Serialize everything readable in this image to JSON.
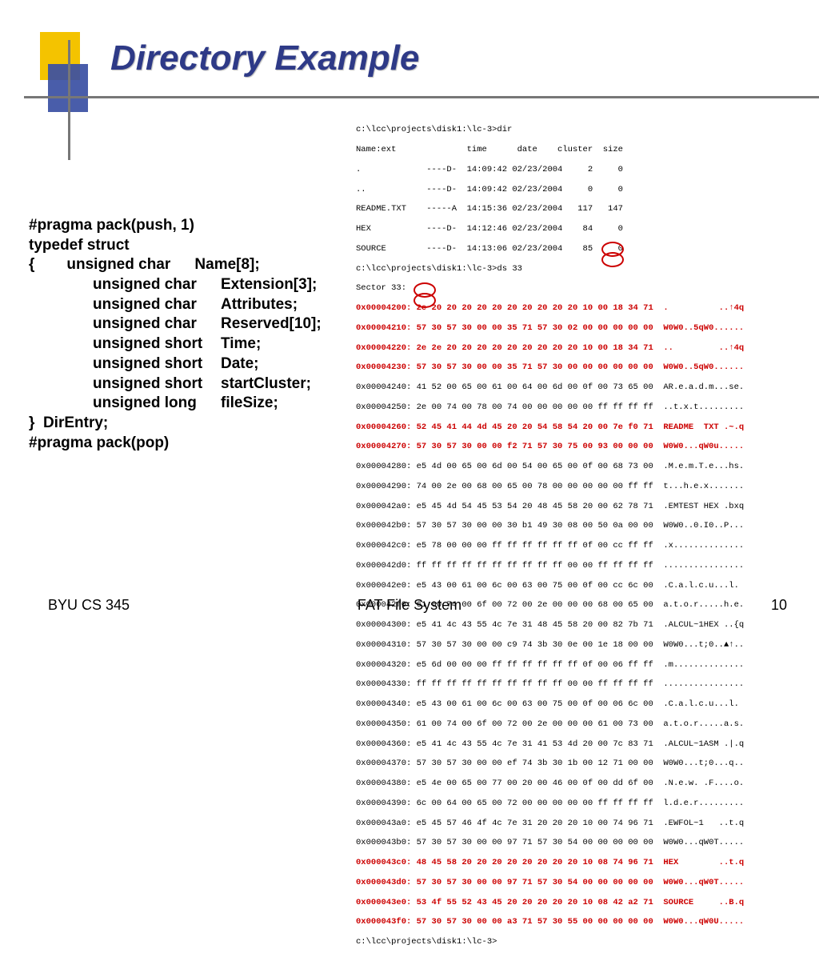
{
  "title": "Directory Example",
  "struct": {
    "l0": "#pragma pack(push, 1)",
    "l1": "typedef struct",
    "l2": "{",
    "f0t": "unsigned char",
    "f0n": "Name[8];",
    "f1t": "unsigned char",
    "f1n": "Extension[3];",
    "f2t": "unsigned char",
    "f2n": "Attributes;",
    "f3t": "unsigned char",
    "f3n": "Reserved[10];",
    "f4t": "unsigned short",
    "f4n": "Time;",
    "f5t": "unsigned short",
    "f5n": "Date;",
    "f6t": "unsigned short",
    "f6n": "startCluster;",
    "f7t": "unsigned long",
    "f7n": "fileSize;",
    "l3": "}  DirEntry;",
    "l4": "#pragma pack(pop)"
  },
  "hex": {
    "h00": "c:\\lcc\\projects\\disk1:\\lc-3>dir",
    "h01": "Name:ext              time      date    cluster  size",
    "h02": ".             ----D-  14:09:42 02/23/2004     2     0",
    "h03": "..            ----D-  14:09:42 02/23/2004     0     0",
    "h04": "README.TXT    -----A  14:15:36 02/23/2004   117   147",
    "h05": "HEX           ----D-  14:12:46 02/23/2004    84     0",
    "h06": "SOURCE        ----D-  14:13:06 02/23/2004    85     0",
    "h07": "c:\\lcc\\projects\\disk1:\\lc-3>ds 33",
    "h08": "Sector 33:",
    "r00": "0x00004200: 2e 20 20 20 20 20 20 20 20 20 20 10 00 18 34 71  .          ..↑4q",
    "r01": "0x00004210: 57 30 57 30 00 00 35 71 57 30 02 00 00 00 00 00  W0W0..5qW0......",
    "r02": "0x00004220: 2e 2e 20 20 20 20 20 20 20 20 20 10 00 18 34 71  ..         ..↑4q",
    "r03": "0x00004230: 57 30 57 30 00 00 35 71 57 30 00 00 00 00 00 00  W0W0..5qW0......",
    "b04": "0x00004240: 41 52 00 65 00 61 00 64 00 6d 00 0f 00 73 65 00  AR.e.a.d.m...se.",
    "b05": "0x00004250: 2e 00 74 00 78 00 74 00 00 00 00 00 ff ff ff ff  ..t.x.t.........",
    "r06": "0x00004260: 52 45 41 44 4d 45 20 20 54 58 54 20 00 7e f0 71  README  TXT .~.q",
    "r07": "0x00004270: 57 30 57 30 00 00 f2 71 57 30 75 00 93 00 00 00  W0W0...qW0u.....",
    "b08": "0x00004280: e5 4d 00 65 00 6d 00 54 00 65 00 0f 00 68 73 00  .M.e.m.T.e...hs.",
    "b09": "0x00004290: 74 00 2e 00 68 00 65 00 78 00 00 00 00 00 ff ff  t...h.e.x.......",
    "b10": "0x000042a0: e5 45 4d 54 45 53 54 20 48 45 58 20 00 62 78 71  .EMTEST HEX .bxq",
    "b11": "0x000042b0: 57 30 57 30 00 00 30 b1 49 30 08 00 50 0a 00 00  W0W0..0.I0..P...",
    "b12": "0x000042c0: e5 78 00 00 00 ff ff ff ff ff ff 0f 00 cc ff ff  .x..............",
    "b13": "0x000042d0: ff ff ff ff ff ff ff ff ff ff 00 00 ff ff ff ff  ................",
    "b14": "0x000042e0: e5 43 00 61 00 6c 00 63 00 75 00 0f 00 cc 6c 00  .C.a.l.c.u...l.",
    "b15": "0x000042f0: 61 00 74 00 6f 00 72 00 2e 00 00 00 68 00 65 00  a.t.o.r.....h.e.",
    "b16": "0x00004300: e5 41 4c 43 55 4c 7e 31 48 45 58 20 00 82 7b 71  .ALCUL~1HEX ..{q",
    "b17": "0x00004310: 57 30 57 30 00 00 c9 74 3b 30 0e 00 1e 18 00 00  W0W0...t;0..▲↑..",
    "b18": "0x00004320: e5 6d 00 00 00 ff ff ff ff ff ff 0f 00 06 ff ff  .m..............",
    "b19": "0x00004330: ff ff ff ff ff ff ff ff ff ff 00 00 ff ff ff ff  ................",
    "b20": "0x00004340: e5 43 00 61 00 6c 00 63 00 75 00 0f 00 06 6c 00  .C.a.l.c.u...l.",
    "b21": "0x00004350: 61 00 74 00 6f 00 72 00 2e 00 00 00 61 00 73 00  a.t.o.r.....a.s.",
    "b22": "0x00004360: e5 41 4c 43 55 4c 7e 31 41 53 4d 20 00 7c 83 71  .ALCUL~1ASM .|.q",
    "b23": "0x00004370: 57 30 57 30 00 00 ef 74 3b 30 1b 00 12 71 00 00  W0W0...t;0...q..",
    "b24": "0x00004380: e5 4e 00 65 00 77 00 20 00 46 00 0f 00 dd 6f 00  .N.e.w. .F....o.",
    "b25": "0x00004390: 6c 00 64 00 65 00 72 00 00 00 00 00 ff ff ff ff  l.d.e.r.........",
    "b26": "0x000043a0: e5 45 57 46 4f 4c 7e 31 20 20 20 10 00 74 96 71  .EWFOL~1   ..t.q",
    "b27": "0x000043b0: 57 30 57 30 00 00 97 71 57 30 54 00 00 00 00 00  W0W0...qW0T.....",
    "r28": "0x000043c0: 48 45 58 20 20 20 20 20 20 20 20 10 08 74 96 71  HEX        ..t.q",
    "r29": "0x000043d0: 57 30 57 30 00 00 97 71 57 30 54 00 00 00 00 00  W0W0...qW0T.....",
    "r30": "0x000043e0: 53 4f 55 52 43 45 20 20 20 20 20 10 08 42 a2 71  SOURCE     ..B.q",
    "r31": "0x000043f0: 57 30 57 30 00 00 a3 71 57 30 55 00 00 00 00 00  W0W0...qW0U.....",
    "h32": "c:\\lcc\\projects\\disk1:\\lc-3>"
  },
  "footer": {
    "left": "BYU CS 345",
    "center": "FAT File System",
    "right": "10"
  }
}
